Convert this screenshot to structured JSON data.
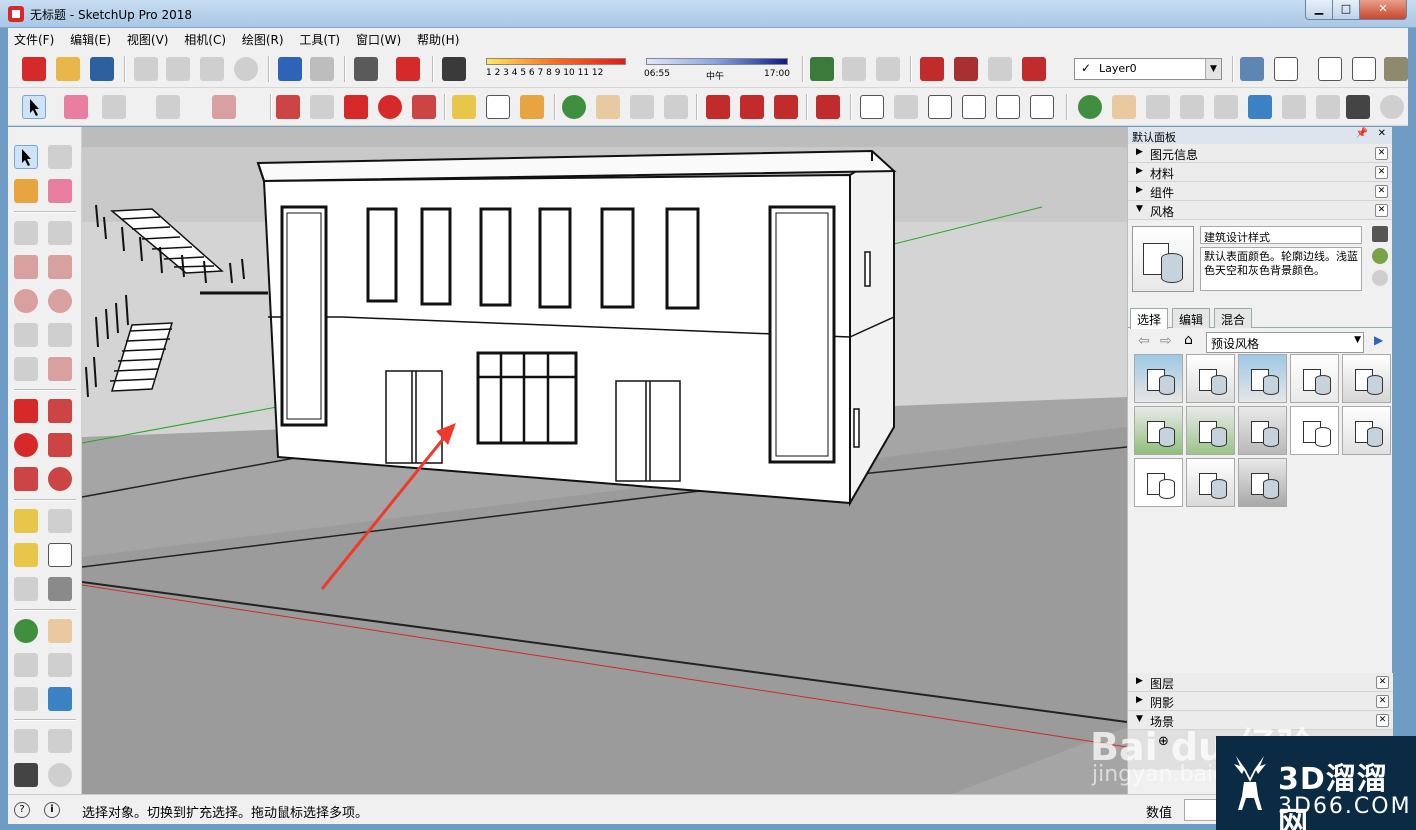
{
  "window": {
    "title": "无标题 - SketchUp Pro 2018",
    "minimize": "▁",
    "maximize": "□",
    "close": "✕"
  },
  "menu": [
    "文件(F)",
    "编辑(E)",
    "视图(V)",
    "相机(C)",
    "绘图(R)",
    "工具(T)",
    "窗口(W)",
    "帮助(H)"
  ],
  "shadow": {
    "months": "1 2 3 4 5 6 7 8 9 10 11 12",
    "time_start": "06:55",
    "time_mid": "中午",
    "time_end": "17:00"
  },
  "layer": {
    "check": "✓",
    "value": "Layer0"
  },
  "tray": {
    "title": "默认面板",
    "sections_top": [
      {
        "label": "图元信息",
        "arrow": "▶"
      },
      {
        "label": "材料",
        "arrow": "▶"
      },
      {
        "label": "组件",
        "arrow": "▶"
      },
      {
        "label": "风格",
        "arrow": "▼"
      }
    ],
    "style_name": "建筑设计样式",
    "style_desc": "默认表面颜色。轮廓边线。浅蓝色天空和灰色背景颜色。",
    "tabs": [
      "选择",
      "编辑",
      "混合"
    ],
    "collection": "预设风格",
    "sections_bottom": [
      {
        "label": "图层",
        "arrow": "▶"
      },
      {
        "label": "阴影",
        "arrow": "▶"
      },
      {
        "label": "场景",
        "arrow": "▼"
      }
    ]
  },
  "status": {
    "text": "选择对象。切换到扩充选择。拖动鼠标选择多项。",
    "measure_label": "数值",
    "info_icon": "i",
    "help_icon": "?"
  },
  "watermark": {
    "brand": "3D溜溜网",
    "url": "3D66.COM",
    "baidu": "Bai du 经验",
    "baidu_url": "jingyan.baidu"
  },
  "colors": {
    "sketchup_red": "#d62a2a",
    "viewport_sky": "#d6d6d6",
    "ground": "#9a9a9a",
    "arrow": "#ee3a2c"
  }
}
